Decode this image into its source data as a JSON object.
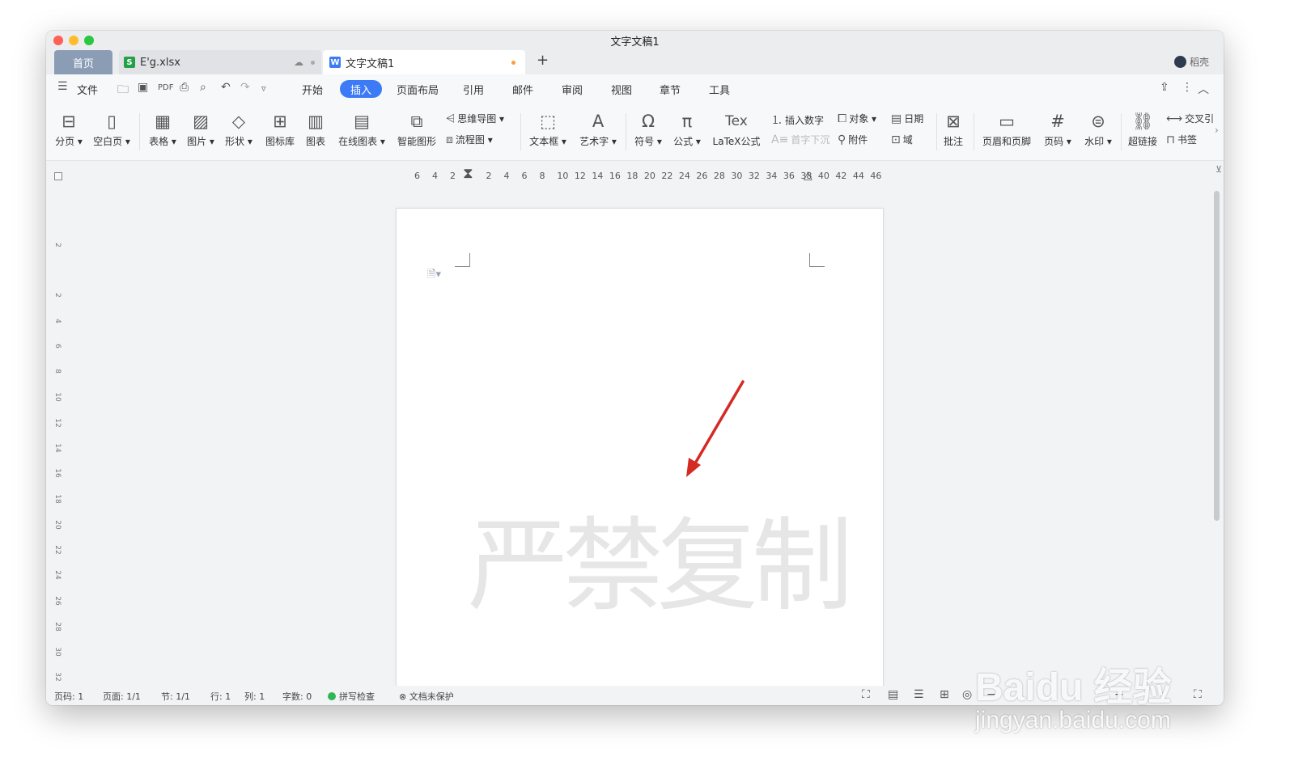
{
  "window": {
    "title": "文字文稿1"
  },
  "tabs": {
    "home": "首页",
    "xlsx": "E'g.xlsx",
    "doc": "文字文稿1",
    "plus": "+",
    "user": "稻壳"
  },
  "menu": {
    "file": "文件",
    "items": [
      "开始",
      "插入",
      "页面布局",
      "引用",
      "邮件",
      "审阅",
      "视图",
      "章节",
      "工具"
    ]
  },
  "ribbon": {
    "page_break": "分页",
    "blank_page": "空白页",
    "table": "表格",
    "picture": "图片",
    "shape": "形状",
    "icon_lib": "图标库",
    "chart": "图表",
    "online_chart": "在线图表",
    "smart_shape": "智能图形",
    "mind_map": "思维导图",
    "flowchart": "流程图",
    "textbox": "文本框",
    "wordart": "艺术字",
    "symbol": "符号",
    "formula": "公式",
    "latex_icon": "Tex",
    "latex": "LaTeX公式",
    "insert_number": "插入数字",
    "drop_cap": "首字下沉",
    "object": "对象",
    "attachment": "附件",
    "date": "日期",
    "field": "域",
    "comment": "批注",
    "header_footer": "页眉和页脚",
    "page_number": "页码",
    "watermark": "水印",
    "hyperlink": "超链接",
    "cross_ref": "交叉引",
    "bookmark": "书签"
  },
  "ruler": {
    "numbers": "6  4  2     2  4  6  8  10 12 14 16 18 20 22 24 26 28 30 32 34 36 38 40 42 44 46",
    "vertical": [
      "2",
      "2",
      "4",
      "6",
      "8",
      "10",
      "12",
      "14",
      "16",
      "18",
      "20",
      "22",
      "24",
      "26",
      "28",
      "30",
      "32"
    ]
  },
  "document": {
    "watermark_text": "严禁复制"
  },
  "status": {
    "page_num": "页码: 1",
    "pages": "页面: 1/1",
    "section": "节: 1/1",
    "row": "行: 1",
    "col": "列: 1",
    "word_count": "字数: 0",
    "spell_check": "拼写检查",
    "protect": "文档未保护"
  },
  "overlay": {
    "brand": "Baidu 经验",
    "url": "jingyan.baidu.com"
  },
  "colors": {
    "accent": "#3d7bf6",
    "arrow": "#d42a24",
    "watermark": "#e6e6e6",
    "spell_ok": "#31b654"
  }
}
